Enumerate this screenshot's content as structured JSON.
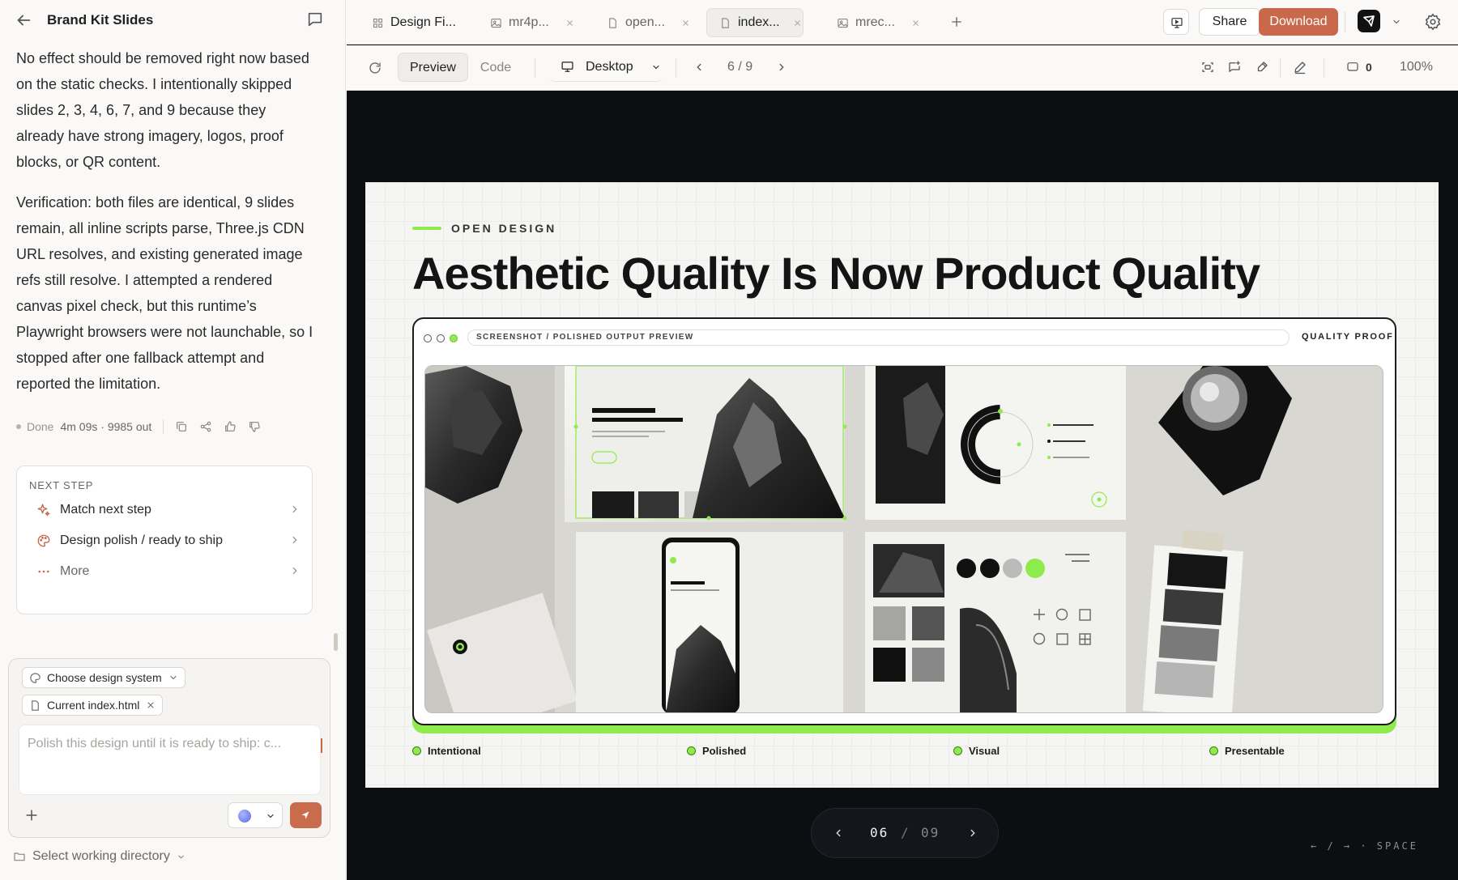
{
  "sidebar": {
    "title": "Brand Kit Slides",
    "messages": [
      "No effect should be removed right now based on the static checks. I intentionally skipped slides 2, 3, 4, 6, 7, and 9 because they already have strong imagery, logos, proof blocks, or QR content.",
      "Verification: both files are identical, 9 slides remain, all inline scripts parse, Three.js CDN URL resolves, and existing generated image refs still resolve. I attempted a rendered canvas pixel check, but this runtime’s Playwright browsers were not launchable, so I stopped after one fallback attempt and reported the limitation."
    ],
    "meta": {
      "status": "Done",
      "stats": "4m 09s · 9985 out"
    },
    "next_step": {
      "label": "NEXT STEP",
      "items": [
        {
          "label": "Match next step",
          "icon": "sparkle-icon"
        },
        {
          "label": "Design polish / ready to ship",
          "icon": "palette-icon"
        },
        {
          "label": "More",
          "icon": "ellipsis-icon"
        }
      ]
    },
    "composer": {
      "design_system_chip": "Choose design system",
      "file_chip": "Current index.html",
      "placeholder": "Polish this design until it is ready to ship: c..."
    },
    "working_directory": "Select working directory"
  },
  "tabs": [
    {
      "label": "Design Fi...",
      "icon": "grid-icon"
    },
    {
      "label": "mr4p...",
      "icon": "image-icon"
    },
    {
      "label": "open...",
      "icon": "file-icon"
    },
    {
      "label": "index...",
      "icon": "file-icon"
    },
    {
      "label": "mrec...",
      "icon": "image-icon"
    }
  ],
  "header_actions": {
    "share": "Share",
    "download": "Download"
  },
  "toolbar": {
    "preview": "Preview",
    "code": "Code",
    "device": "Desktop",
    "page": "6 / 9",
    "comments": "0",
    "zoom": "100%"
  },
  "slide": {
    "kicker": "OPEN DESIGN",
    "headline": "Aesthetic Quality Is Now Product Quality",
    "frame_url": "SCREENSHOT / POLISHED OUTPUT PREVIEW",
    "frame_badge": "QUALITY PROOF",
    "features": [
      "Intentional",
      "Polished",
      "Visual",
      "Presentable"
    ]
  },
  "pager": {
    "current": "06",
    "separator": "/",
    "total": "09"
  },
  "keyboard_hint": "← / → · SPACE",
  "colors": {
    "accent": "#c9684a",
    "slide_green": "#8fea4c",
    "canvas": "#0d0e12"
  }
}
